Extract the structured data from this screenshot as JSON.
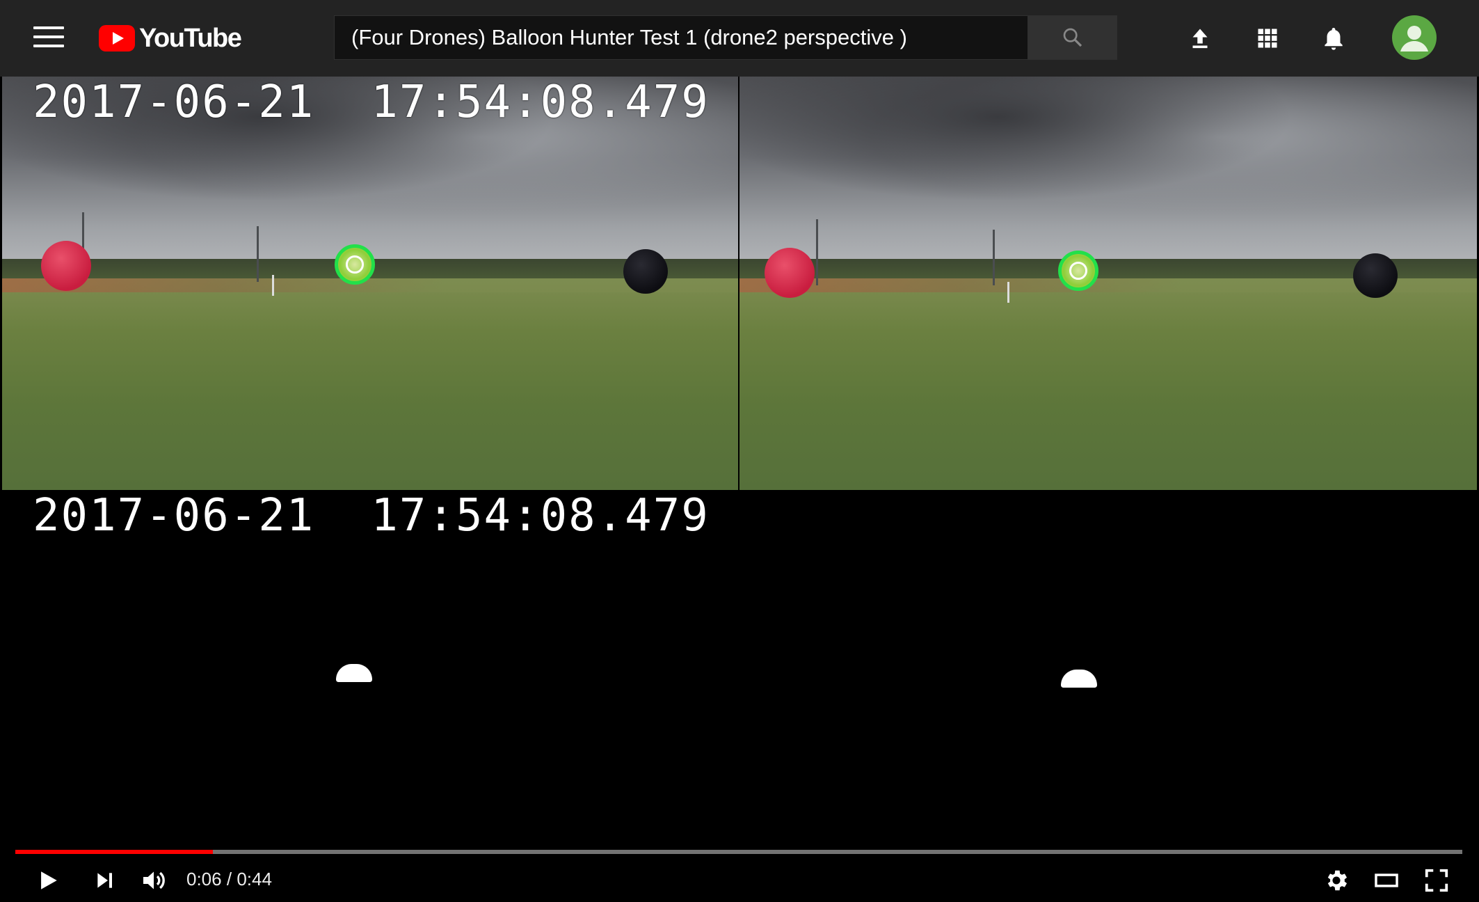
{
  "header": {
    "logo_text": "YouTube",
    "search_value": "(Four Drones) Balloon Hunter Test 1 (drone2 perspective )",
    "icons": [
      "menu-icon",
      "youtube-logo-icon",
      "search-icon",
      "upload-icon",
      "apps-icon",
      "notifications-bell-icon",
      "account-avatar-icon"
    ]
  },
  "video": {
    "timestamp_top": "2017-06-21  17:54:08.479",
    "timestamp_bottom": "2017-06-21  17:54:08.479"
  },
  "player": {
    "current_time": "0:06",
    "separator": "/",
    "duration": "0:44",
    "progress_fraction": 0.1364,
    "icons": [
      "play-icon",
      "next-icon",
      "volume-icon",
      "settings-gear-icon",
      "theater-mode-icon",
      "fullscreen-icon"
    ]
  },
  "colors": {
    "masthead_bg": "#232323",
    "brand_red": "#ff0000",
    "progress_red": "#ff0000",
    "avatar_green": "#5ba843",
    "target_green": "#22e04a"
  }
}
